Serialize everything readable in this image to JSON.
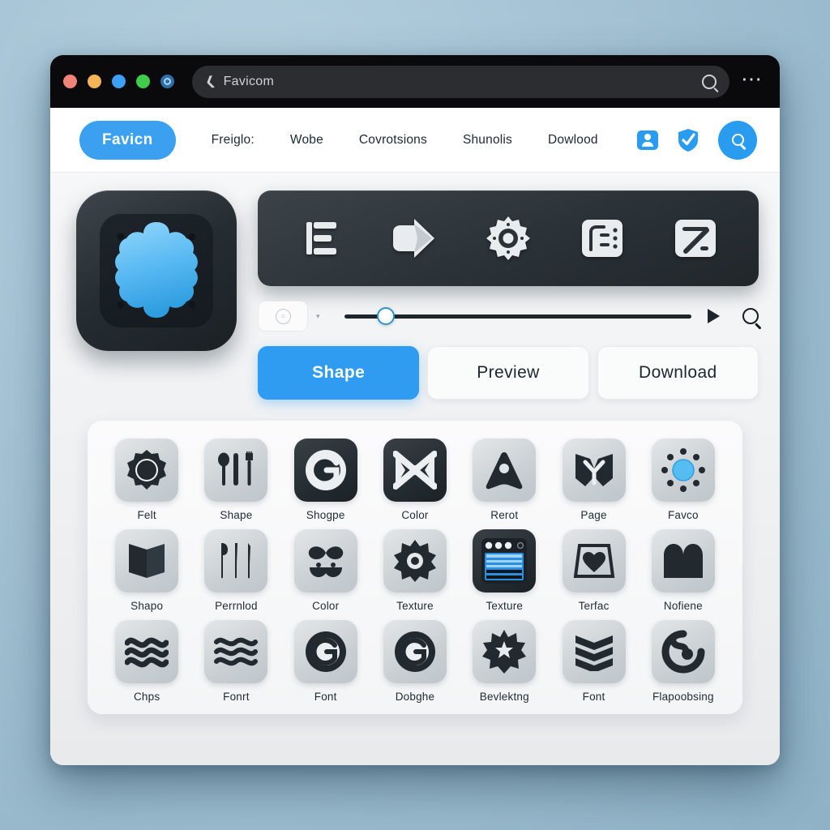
{
  "window": {
    "titlebar": {
      "dots": [
        {
          "name": "close-dot",
          "color": "#f08478"
        },
        {
          "name": "minimize-dot",
          "color": "#f3b557"
        },
        {
          "name": "expand-dot",
          "color": "#3da0f5"
        },
        {
          "name": "maximize-dot",
          "color": "#3fcc4a"
        },
        {
          "name": "app-dot",
          "color": "#2f6fa8"
        }
      ],
      "url_value": "Favicom",
      "url_placeholder": "Favicom",
      "back_icon": "chevron-back-icon",
      "search_icon": "search-icon",
      "menu_icon": "kebab-menu-icon"
    }
  },
  "nav": {
    "brand": "Favicn",
    "links": [
      "Freiglo:",
      "Wobe",
      "Covrotsions",
      "Shunolis",
      "Dowlood"
    ],
    "icons": [
      "contact-card-icon",
      "shield-check-icon",
      "search-icon"
    ]
  },
  "editor": {
    "preview_icon_name": "favicon-preview-blob",
    "toolbar_icons": [
      "align-list-icon",
      "arrow-right-icon",
      "gear-icon",
      "layout-panel-icon",
      "slash-shape-icon"
    ],
    "stepper": {
      "glyph": "circle-glyph",
      "caret": "▾"
    },
    "slider": {
      "value_percent": 12,
      "play_icon": "play-icon",
      "search_icon": "search-icon"
    },
    "tabs": [
      {
        "label": "Shape",
        "active": true
      },
      {
        "label": "Preview",
        "active": false
      },
      {
        "label": "Download",
        "active": false
      }
    ]
  },
  "colors": {
    "accent": "#2f9cf1",
    "brand": "#3ba0f0",
    "dark_panel": "#2b3237",
    "page_bg": "#a4c2d4"
  },
  "grid": {
    "items": [
      {
        "label": "Felt",
        "icon": "gear-circle-icon",
        "tone": "light"
      },
      {
        "label": "Shape",
        "icon": "cutlery-icon",
        "tone": "light"
      },
      {
        "label": "Shogpe",
        "icon": "letter-g-icon",
        "tone": "dark"
      },
      {
        "label": "Color",
        "icon": "bowtie-x-icon",
        "tone": "dark"
      },
      {
        "label": "Rerot",
        "icon": "navigation-arrow-icon",
        "tone": "light"
      },
      {
        "label": "Page",
        "icon": "butterfly-icon",
        "tone": "light"
      },
      {
        "label": "Favco",
        "icon": "sun-dots-icon",
        "tone": "light"
      },
      {
        "label": "Shapo",
        "icon": "open-book-icon",
        "tone": "light"
      },
      {
        "label": "Perrnlod",
        "icon": "cutlery-thin-icon",
        "tone": "light"
      },
      {
        "label": "Color",
        "icon": "mustache-face-icon",
        "tone": "light"
      },
      {
        "label": "Texture",
        "icon": "starburst-eye-icon",
        "tone": "light"
      },
      {
        "label": "Texture",
        "icon": "browser-window-icon",
        "tone": "dark"
      },
      {
        "label": "Terfac",
        "icon": "heart-frame-icon",
        "tone": "light"
      },
      {
        "label": "Nofiene",
        "icon": "arch-shape-icon",
        "tone": "light"
      },
      {
        "label": "Chps",
        "icon": "waves-icon",
        "tone": "light"
      },
      {
        "label": "Fonrt",
        "icon": "waves-thin-icon",
        "tone": "light"
      },
      {
        "label": "Font",
        "icon": "g-target-icon",
        "tone": "light"
      },
      {
        "label": "Dobghe",
        "icon": "g-target-icon",
        "tone": "light"
      },
      {
        "label": "Bevlektng",
        "icon": "star-burst-icon",
        "tone": "light"
      },
      {
        "label": "Font",
        "icon": "chevrons-icon",
        "tone": "light"
      },
      {
        "label": "Flapoobsing",
        "icon": "spiral-arrow-icon",
        "tone": "light"
      }
    ]
  }
}
